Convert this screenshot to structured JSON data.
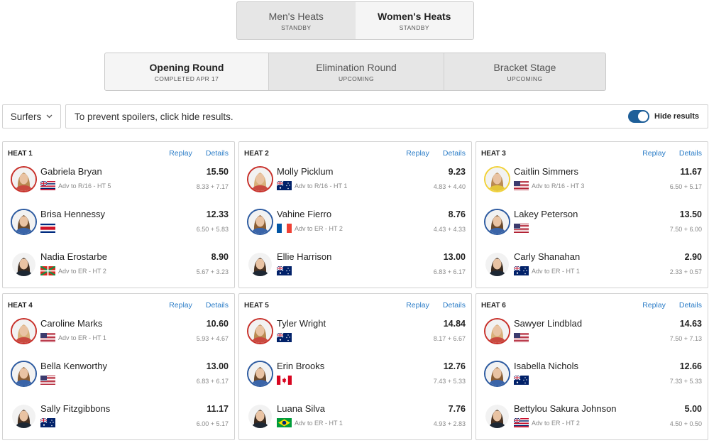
{
  "colors": {
    "accent": "#2a7cc7",
    "toggle": "#1e5f99",
    "border_red": "#c8312b",
    "border_blue": "#2c5aa0",
    "border_yellow": "#f1d23a"
  },
  "top_tabs": [
    {
      "title": "Men's Heats",
      "sub": "STANDBY",
      "active": false
    },
    {
      "title": "Women's Heats",
      "sub": "STANDBY",
      "active": true
    }
  ],
  "round_tabs": [
    {
      "title": "Opening Round",
      "sub": "COMPLETED APR 17",
      "active": true
    },
    {
      "title": "Elimination Round",
      "sub": "UPCOMING",
      "active": false
    },
    {
      "title": "Bracket Stage",
      "sub": "UPCOMING",
      "active": false
    }
  ],
  "filter": {
    "label": "Surfers",
    "icon": "chevron-down-icon"
  },
  "notice": {
    "text": "To prevent spoilers, click hide results.",
    "toggle_label": "Hide results",
    "toggle_on": true
  },
  "heat_links": {
    "replay": "Replay",
    "details": "Details"
  },
  "heats": [
    {
      "title": "HEAT 1",
      "surfers": [
        {
          "name": "Gabriela Bryan",
          "total": "15.50",
          "waves": "8.33 + 7.17",
          "adv": "Adv to R/16 - HT 5",
          "flag": "hawaii",
          "jersey": "red"
        },
        {
          "name": "Brisa Hennessy",
          "total": "12.33",
          "waves": "6.50 + 5.83",
          "adv": "",
          "flag": "costa-rica",
          "jersey": "blue"
        },
        {
          "name": "Nadia Erostarbe",
          "total": "8.90",
          "waves": "5.67 + 3.23",
          "adv": "Adv to ER - HT 2",
          "flag": "basque",
          "jersey": "white"
        }
      ]
    },
    {
      "title": "HEAT 2",
      "surfers": [
        {
          "name": "Molly Picklum",
          "total": "9.23",
          "waves": "4.83 + 4.40",
          "adv": "Adv to R/16 - HT 1",
          "flag": "australia",
          "jersey": "red"
        },
        {
          "name": "Vahine Fierro",
          "total": "8.76",
          "waves": "4.43 + 4.33",
          "adv": "Adv to ER - HT 2",
          "flag": "france",
          "jersey": "blue"
        },
        {
          "name": "Ellie Harrison",
          "total": "13.00",
          "waves": "6.83 + 6.17",
          "adv": "",
          "flag": "australia",
          "jersey": "white"
        }
      ]
    },
    {
      "title": "HEAT 3",
      "surfers": [
        {
          "name": "Caitlin Simmers",
          "total": "11.67",
          "waves": "6.50 + 5.17",
          "adv": "Adv to R/16 - HT 3",
          "flag": "usa",
          "jersey": "yellow"
        },
        {
          "name": "Lakey Peterson",
          "total": "13.50",
          "waves": "7.50 + 6.00",
          "adv": "",
          "flag": "usa",
          "jersey": "blue"
        },
        {
          "name": "Carly Shanahan",
          "total": "2.90",
          "waves": "2.33 + 0.57",
          "adv": "Adv to ER - HT 1",
          "flag": "australia",
          "jersey": "white"
        }
      ]
    },
    {
      "title": "HEAT 4",
      "surfers": [
        {
          "name": "Caroline Marks",
          "total": "10.60",
          "waves": "5.93 + 4.67",
          "adv": "Adv to ER - HT 1",
          "flag": "usa",
          "jersey": "red"
        },
        {
          "name": "Bella Kenworthy",
          "total": "13.00",
          "waves": "6.83 + 6.17",
          "adv": "",
          "flag": "usa",
          "jersey": "blue"
        },
        {
          "name": "Sally Fitzgibbons",
          "total": "11.17",
          "waves": "6.00 + 5.17",
          "adv": "",
          "flag": "australia",
          "jersey": "white"
        }
      ]
    },
    {
      "title": "HEAT 5",
      "surfers": [
        {
          "name": "Tyler Wright",
          "total": "14.84",
          "waves": "8.17 + 6.67",
          "adv": "",
          "flag": "australia",
          "jersey": "red"
        },
        {
          "name": "Erin Brooks",
          "total": "12.76",
          "waves": "7.43 + 5.33",
          "adv": "",
          "flag": "canada",
          "jersey": "blue"
        },
        {
          "name": "Luana Silva",
          "total": "7.76",
          "waves": "4.93 + 2.83",
          "adv": "Adv to ER - HT 1",
          "flag": "brazil",
          "jersey": "white"
        }
      ]
    },
    {
      "title": "HEAT 6",
      "surfers": [
        {
          "name": "Sawyer Lindblad",
          "total": "14.63",
          "waves": "7.50 + 7.13",
          "adv": "",
          "flag": "usa",
          "jersey": "red"
        },
        {
          "name": "Isabella Nichols",
          "total": "12.66",
          "waves": "7.33 + 5.33",
          "adv": "",
          "flag": "australia",
          "jersey": "blue"
        },
        {
          "name": "Bettylou Sakura Johnson",
          "total": "5.00",
          "waves": "4.50 + 0.50",
          "adv": "Adv to ER - HT 2",
          "flag": "hawaii",
          "jersey": "white"
        }
      ]
    }
  ]
}
